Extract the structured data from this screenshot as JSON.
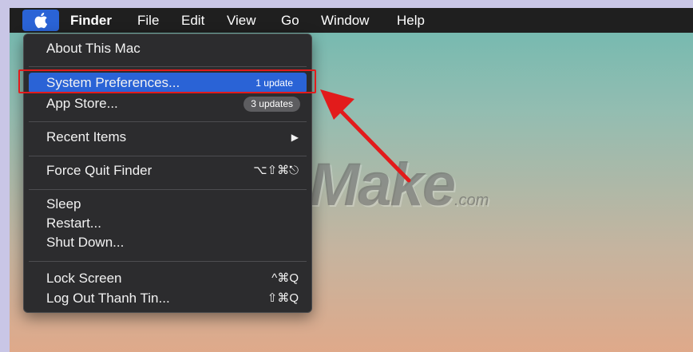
{
  "menubar": {
    "apple_icon": "apple-logo-icon",
    "items": [
      {
        "label": "Finder"
      },
      {
        "label": "File"
      },
      {
        "label": "Edit"
      },
      {
        "label": "View"
      },
      {
        "label": "Go"
      },
      {
        "label": "Window"
      },
      {
        "label": "Help"
      }
    ]
  },
  "apple_menu": {
    "about": "About This Mac",
    "system_preferences": "System Preferences...",
    "system_preferences_badge": "1 update",
    "app_store": "App Store...",
    "app_store_badge": "3 updates",
    "recent_items": "Recent Items",
    "recent_items_arrow": "▶",
    "force_quit": "Force Quit Finder",
    "force_quit_shortcut": "⌥⇧⌘⎋",
    "sleep": "Sleep",
    "restart": "Restart...",
    "shut_down": "Shut Down...",
    "lock_screen": "Lock Screen",
    "lock_screen_shortcut": "^⌘Q",
    "log_out": "Log Out Thanh Tin...",
    "log_out_shortcut": "⇧⌘Q"
  },
  "watermark": {
    "text": "TipsMake",
    "suffix": ".com"
  },
  "colors": {
    "selection": "#2a63d6",
    "annotation": "#e21b1b",
    "menubar": "#1f1f1f",
    "menu_bg": "#2c2c2e"
  }
}
